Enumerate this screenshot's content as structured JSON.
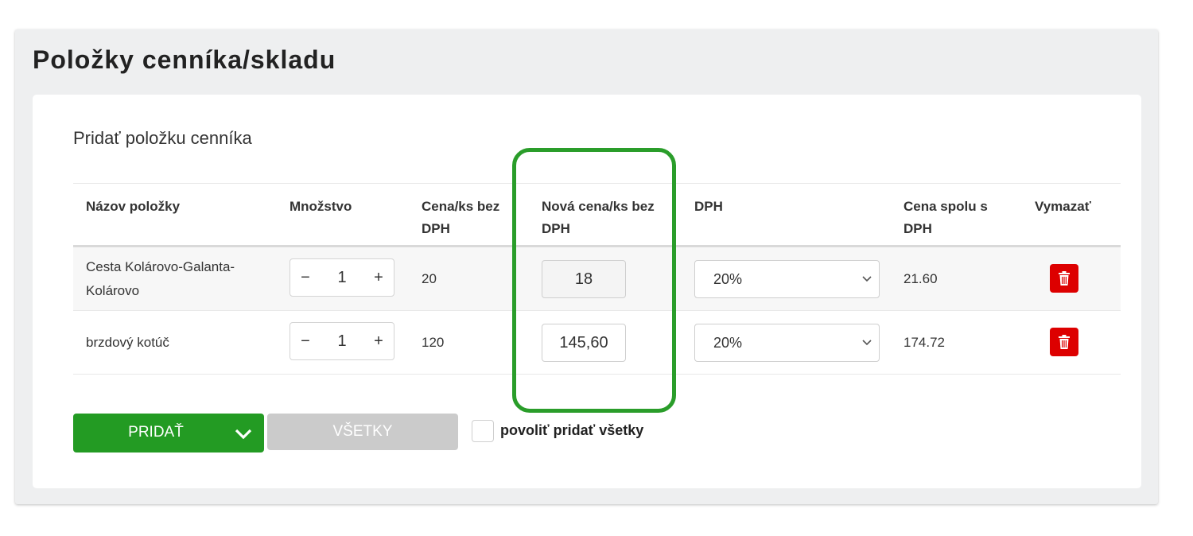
{
  "page": {
    "title": "Položky cenníka/skladu"
  },
  "section": {
    "title": "Pridať položku cenníka"
  },
  "table": {
    "headers": {
      "name": "Názov položky",
      "quantity": "Množstvo",
      "price_l1": "Cena/ks bez",
      "price_l2": "DPH",
      "new_price_l1": "Nová cena/ks bez",
      "new_price_l2": "DPH",
      "vat": "DPH",
      "total_l1": "Cena spolu s",
      "total_l2": "DPH",
      "delete": "Vymazať"
    },
    "rows": [
      {
        "name_l1": "Cesta Kolárovo-Galanta-",
        "name_l2": "Kolárovo",
        "minus": "−",
        "qty": "1",
        "plus": "+",
        "price": "20",
        "new_price": "18",
        "vat": "20%",
        "total": "21.60"
      },
      {
        "name_l1": "brzdový kotúč",
        "name_l2": "",
        "minus": "−",
        "qty": "1",
        "plus": "+",
        "price": "120",
        "new_price": "145,60",
        "vat": "20%",
        "total": "174.72"
      }
    ]
  },
  "actions": {
    "add_label": "PRIDAŤ",
    "all_label": "VŠETKY",
    "allow_all_label": "povoliť pridať všetky"
  },
  "colors": {
    "accent_green": "#239b23",
    "highlight_green": "#2a9d2a",
    "delete_red": "#dd0000",
    "disabled_gray": "#cbcbcb"
  },
  "icons": {
    "delete": "trash-icon",
    "dropdown": "chevron-down-icon"
  }
}
